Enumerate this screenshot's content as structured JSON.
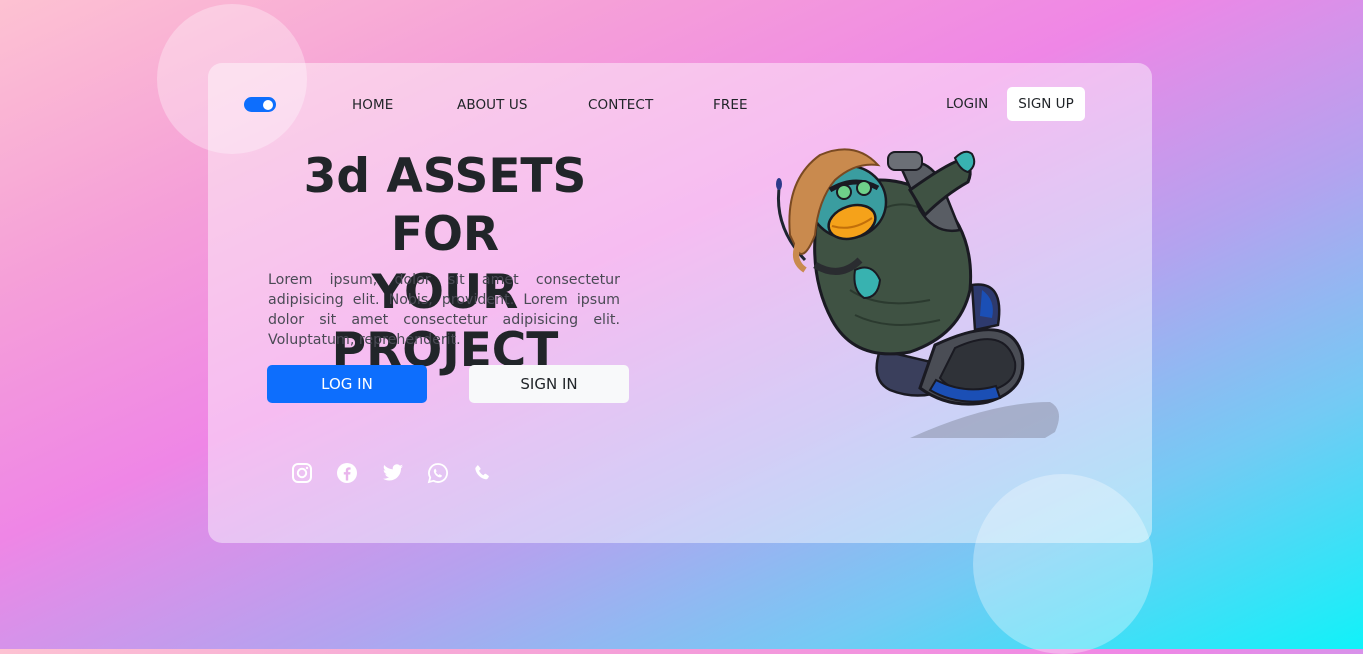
{
  "nav": {
    "items": [
      "HOME",
      "ABOUT US",
      "CONTECT",
      "FREE"
    ],
    "login_label": "LOGIN",
    "signup_label": "SIGN UP"
  },
  "hero": {
    "title_line1": "3d ASSETS FOR",
    "title_line2": "YOUR PROJECT",
    "description": "Lorem ipsum, dolor sit amet consectetur adipisicing elit. Nobis, provident. Lorem ipsum dolor sit amet consectetur adipisicing elit. Voluptatum, reprehenderit.",
    "login_button": "LOG IN",
    "signin_button": "SIGN IN"
  },
  "social": [
    "instagram-icon",
    "facebook-icon",
    "twitter-icon",
    "whatsapp-icon",
    "phone-icon"
  ],
  "colors": {
    "primary": "#0d6efd",
    "text": "#212529",
    "card": "rgba(255,255,255,0.45)"
  },
  "toggle": {
    "state": "on"
  }
}
